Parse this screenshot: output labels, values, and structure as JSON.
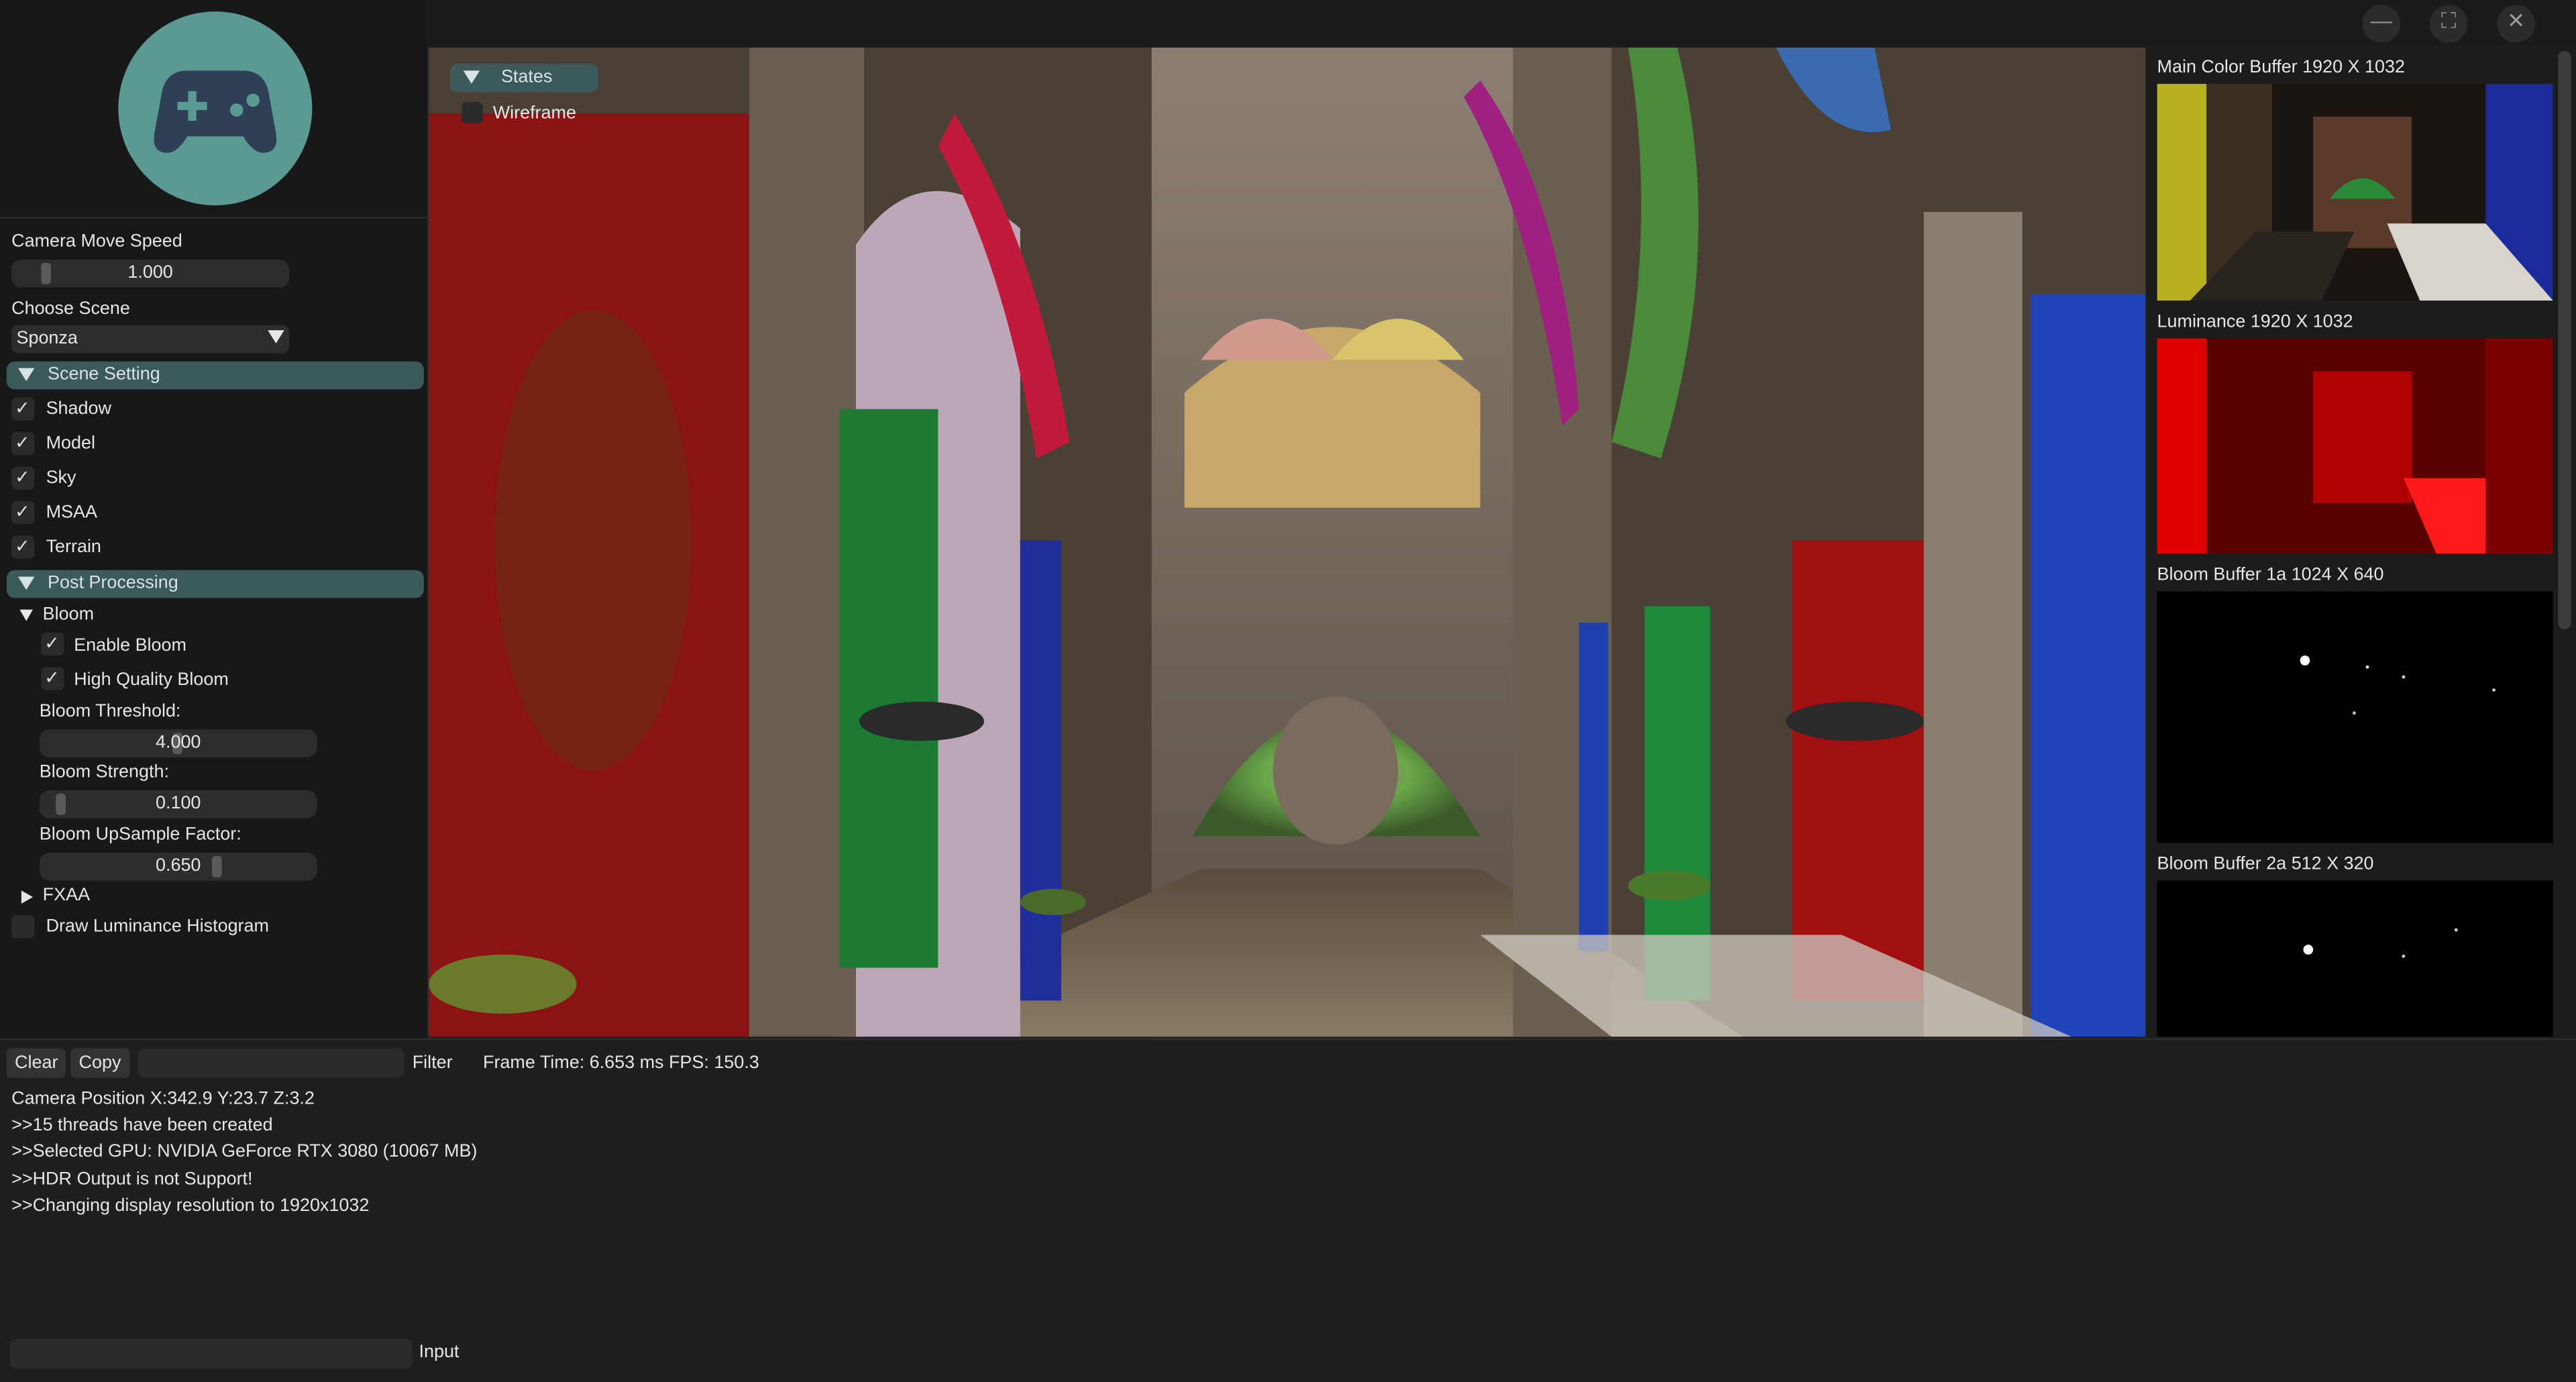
{
  "left_panel": {
    "camera_speed": {
      "label": "Camera Move Speed",
      "value": "1.000"
    },
    "choose_scene": {
      "label": "Choose Scene",
      "value": "Sponza"
    },
    "scene_setting": {
      "header": "Scene Setting",
      "items": [
        {
          "label": "Shadow",
          "checked": true
        },
        {
          "label": "Model",
          "checked": true
        },
        {
          "label": "Sky",
          "checked": true
        },
        {
          "label": "MSAA",
          "checked": true
        },
        {
          "label": "Terrain",
          "checked": true
        }
      ]
    },
    "post_processing": {
      "header": "Post Processing",
      "bloom": {
        "label": "Bloom",
        "enable_label": "Enable Bloom",
        "hq_label": "High Quality Bloom",
        "threshold_label": "Bloom Threshold:",
        "threshold_value": "4.000",
        "strength_label": "Bloom Strength:",
        "strength_value": "0.100",
        "upsample_label": "Bloom UpSample Factor:",
        "upsample_value": "0.650"
      },
      "fxaa_label": "FXAA",
      "histogram_label": "Draw Luminance Histogram"
    }
  },
  "viewport": {
    "states_header": "States",
    "wireframe_label": "Wireframe"
  },
  "buffers": [
    {
      "label": "Main Color Buffer  1920 X 1032"
    },
    {
      "label": "Luminance  1920 X 1032"
    },
    {
      "label": "Bloom Buffer 1a  1024 X 640"
    },
    {
      "label": "Bloom Buffer 2a  512 X 320"
    }
  ],
  "console": {
    "clear_label": "Clear",
    "copy_label": "Copy",
    "filter_label": "Filter",
    "stats": "Frame Time: 6.653 ms  FPS: 150.3",
    "lines": [
      "Camera Position X:342.9 Y:23.7 Z:3.2",
      ">>15 threads have been created",
      ">>Selected GPU:  NVIDIA GeForce RTX 3080 (10067 MB)",
      ">>HDR Output is not Support!",
      ">>Changing display resolution to 1920x1032"
    ],
    "input_label": "Input"
  },
  "window_controls": {
    "minimize": "—",
    "maximize": "⛶",
    "close": "✕"
  },
  "colors": {
    "accent": "#3c5a5a",
    "logo_bg": "#5b9a93",
    "panel_bg": "#181818"
  }
}
